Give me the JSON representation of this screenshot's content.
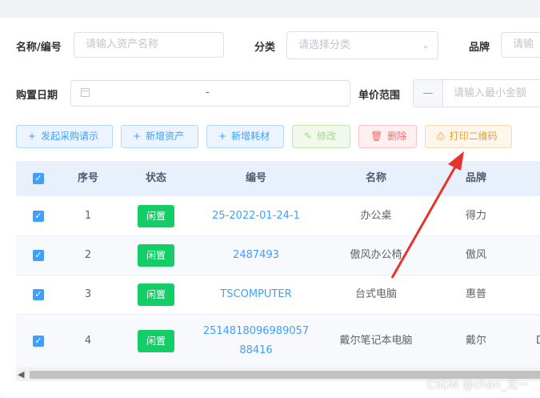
{
  "filters": {
    "name_label": "名称/编号",
    "name_placeholder": "请输入资产名称",
    "category_label": "分类",
    "category_placeholder": "请选择分类",
    "brand_label": "品牌",
    "brand_placeholder": "请输",
    "date_label": "购置日期",
    "date_separator": "-",
    "price_label": "单价范围",
    "price_minus": "—",
    "price_min_placeholder": "请输入最小金额"
  },
  "toolbar": {
    "purchase": "发起采购请示",
    "add_asset": "新增资产",
    "add_consumable": "新增耗材",
    "edit": "修改",
    "delete": "删除",
    "print_qr": "打印二维码"
  },
  "table": {
    "headers": [
      "序号",
      "状态",
      "编号",
      "名称",
      "品牌"
    ],
    "rows": [
      {
        "index": "1",
        "status": "闲置",
        "code": "25-2022-01-24-1",
        "name": "办公桌",
        "brand": "得力"
      },
      {
        "index": "2",
        "status": "闲置",
        "code": "2487493",
        "name": "傲风办公椅",
        "brand": "傲风"
      },
      {
        "index": "3",
        "status": "闲置",
        "code": "TSCOMPUTER",
        "name": "台式电脑",
        "brand": "惠普"
      },
      {
        "index": "4",
        "status": "闲置",
        "code_line1": "2514818096989057",
        "code_line2": "88416",
        "name": "戴尔笔记本电脑",
        "brand": "戴尔",
        "extra": "D"
      }
    ]
  },
  "watermark": "CSDN @chen_北一",
  "colors": {
    "primary": "#409eff",
    "status_tag": "#13ce66",
    "danger": "#f56c6c",
    "warning": "#e6a23c",
    "annotation_arrow": "#e8332a"
  }
}
